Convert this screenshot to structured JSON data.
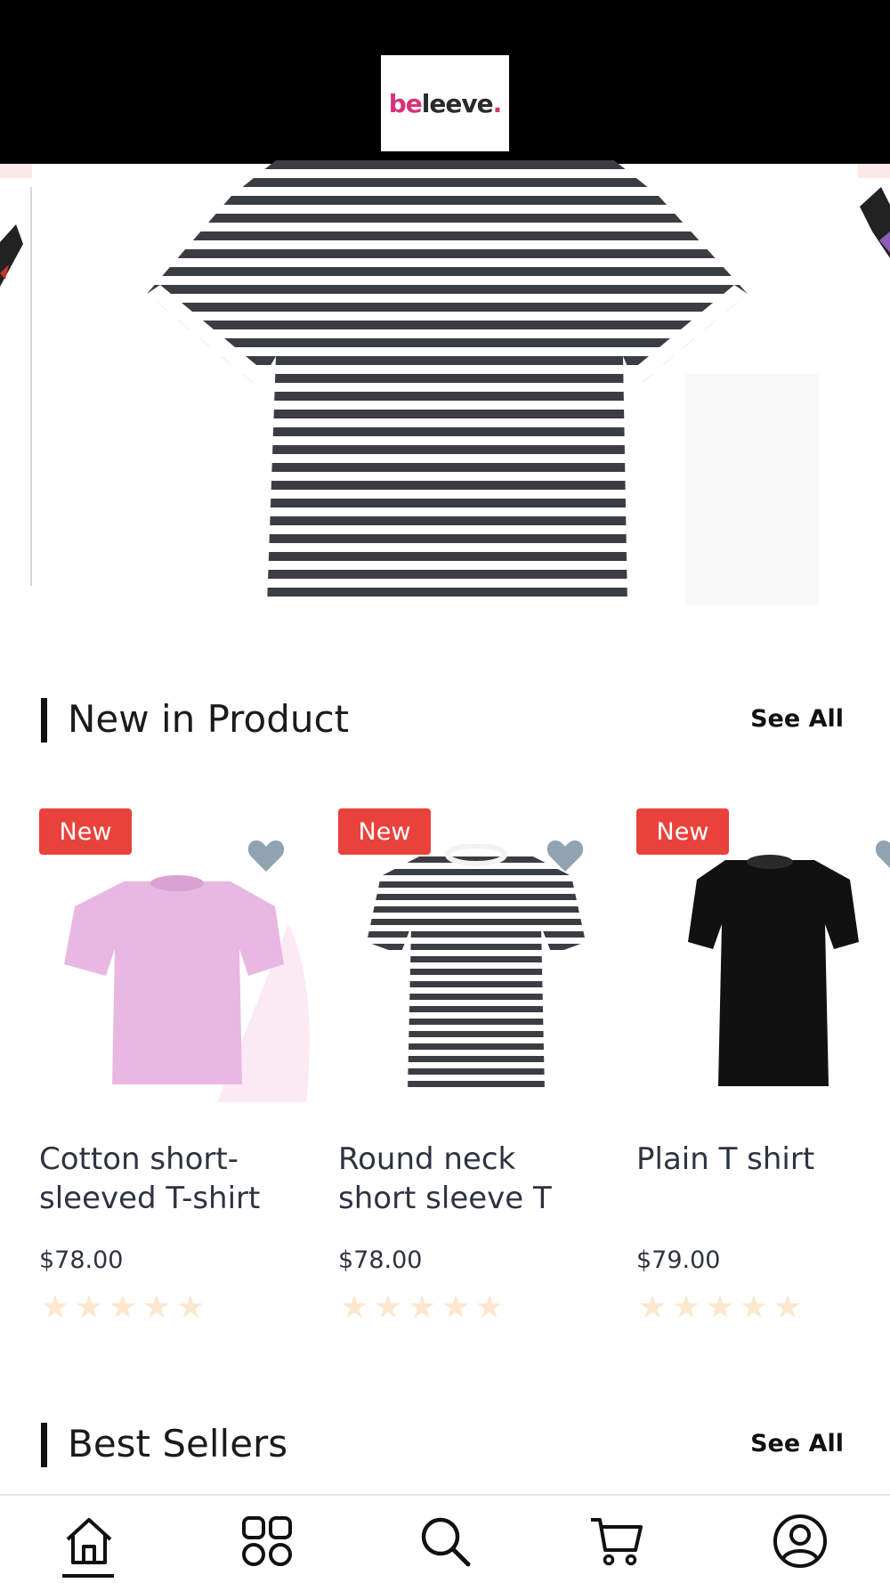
{
  "brand": {
    "logo_part1": "be",
    "logo_part2": "leeve",
    "logo_dot": "."
  },
  "new_in": {
    "title": "New in Product",
    "see_all": "See All",
    "products": [
      {
        "badge": "New",
        "title_line1": "Cotton short-",
        "title_line2": "sleeved T-shirt",
        "price": "$78.00",
        "rating": 0,
        "image_icon": "pink-tshirt-image"
      },
      {
        "badge": "New",
        "title_line1": "Round neck",
        "title_line2": "short sleeve T",
        "price": "$78.00",
        "rating": 0,
        "image_icon": "striped-tshirt-image"
      },
      {
        "badge": "New",
        "title_line1": "Plain T shirt",
        "title_line2": "",
        "price": "$79.00",
        "rating": 0,
        "image_icon": "black-tshirt-image"
      }
    ]
  },
  "best_sellers": {
    "title": "Best Sellers",
    "see_all": "See All"
  },
  "nav": {
    "items": [
      "home-icon",
      "categories-icon",
      "search-icon",
      "cart-icon",
      "profile-icon"
    ],
    "active": "home-icon"
  },
  "colors": {
    "topbar": "#000000",
    "badge": "#e8423b",
    "heart": "#8fa3b0",
    "star_empty": "#fde7cf",
    "logo_pink": "#d6337a"
  }
}
